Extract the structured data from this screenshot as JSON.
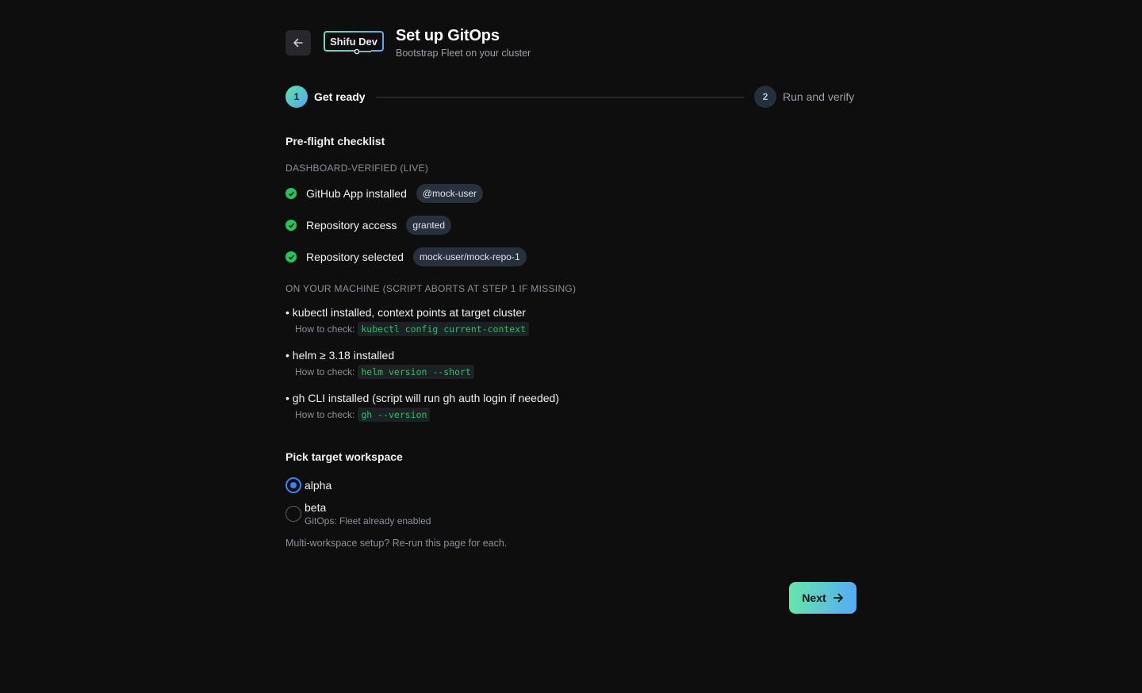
{
  "header": {
    "logo_text": "Shifu Dev",
    "title": "Set up GitOps",
    "subtitle": "Bootstrap Fleet on your cluster"
  },
  "stepper": {
    "steps": [
      {
        "number": "1",
        "label": "Get ready",
        "active": true
      },
      {
        "number": "2",
        "label": "Run and verify",
        "active": false
      }
    ]
  },
  "checklist": {
    "title": "Pre-flight checklist",
    "dashboard_heading": "DASHBOARD-VERIFIED (LIVE)",
    "verified": [
      {
        "label": "GitHub App installed",
        "value": "@mock-user"
      },
      {
        "label": "Repository access",
        "value": "granted"
      },
      {
        "label": "Repository selected",
        "value": "mock-user/mock-repo-1"
      }
    ],
    "machine_heading": "ON YOUR MACHINE (SCRIPT ABORTS AT STEP 1 IF MISSING)",
    "how_prefix": "How to check:",
    "requirements": [
      {
        "title": "• kubectl installed, context points at target cluster",
        "command": "kubectl config current-context"
      },
      {
        "title": "• helm ≥ 3.18 installed",
        "command": "helm version --short"
      },
      {
        "title": "• gh CLI installed (script will run gh auth login if needed)",
        "command": "gh --version"
      }
    ]
  },
  "workspace": {
    "title": "Pick target workspace",
    "options": [
      {
        "label": "alpha",
        "note": "",
        "selected": true
      },
      {
        "label": "beta",
        "note": "GitOps: Fleet already enabled",
        "selected": false
      }
    ],
    "footnote": "Multi-workspace setup? Re-run this page for each."
  },
  "actions": {
    "next_label": "Next"
  },
  "colors": {
    "accent_blue": "#3b82f6",
    "success_green": "#22c55e",
    "gradient_start": "#66e6a9",
    "gradient_end": "#55abf5"
  }
}
